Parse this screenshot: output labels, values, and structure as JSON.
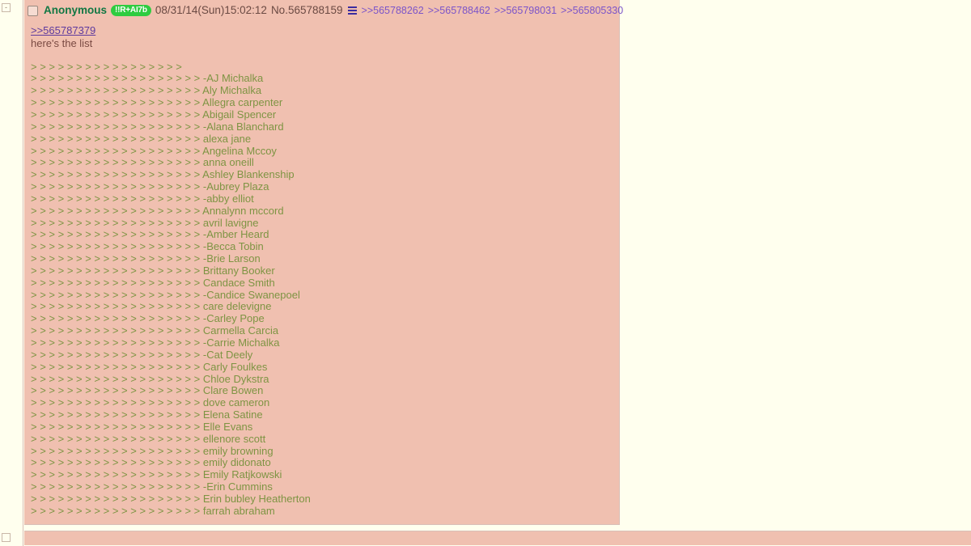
{
  "post": {
    "collapse_label": "-",
    "name": "Anonymous",
    "tripcode_badge": "!!R+AI7b",
    "datetime": "08/31/14(Sun)15:02:12",
    "post_number": "No.565788159",
    "menu_icon": "hamburger-menu-icon",
    "backlinks": [
      ">>565788262",
      ">>565788462",
      ">>565798031",
      ">>565805330"
    ],
    "message": {
      "quotelink": ">>565787379",
      "intro": "here's the list",
      "green_lines": [
        "> > > > > > > > > > > > > > > > >",
        "> > > > > > > > > > > > > > > > > > > -AJ Michalka",
        "> > > > > > > > > > > > > > > > > > > Aly Michalka",
        "> > > > > > > > > > > > > > > > > > > Allegra carpenter",
        "> > > > > > > > > > > > > > > > > > > Abigail Spencer",
        "> > > > > > > > > > > > > > > > > > > -Alana Blanchard",
        "> > > > > > > > > > > > > > > > > > > alexa jane",
        "> > > > > > > > > > > > > > > > > > > Angelina Mccoy",
        "> > > > > > > > > > > > > > > > > > > anna oneill",
        "> > > > > > > > > > > > > > > > > > > Ashley Blankenship",
        "> > > > > > > > > > > > > > > > > > > -Aubrey Plaza",
        "> > > > > > > > > > > > > > > > > > > -abby elliot",
        "> > > > > > > > > > > > > > > > > > > Annalynn mccord",
        "> > > > > > > > > > > > > > > > > > > avril lavigne",
        "> > > > > > > > > > > > > > > > > > > -Amber Heard",
        "> > > > > > > > > > > > > > > > > > > -Becca Tobin",
        "> > > > > > > > > > > > > > > > > > > -Brie Larson",
        "> > > > > > > > > > > > > > > > > > > Brittany Booker",
        "> > > > > > > > > > > > > > > > > > > Candace Smith",
        "> > > > > > > > > > > > > > > > > > > -Candice Swanepoel",
        "> > > > > > > > > > > > > > > > > > > care delevigne",
        "> > > > > > > > > > > > > > > > > > > -Carley Pope",
        "> > > > > > > > > > > > > > > > > > > Carmella Carcia",
        "> > > > > > > > > > > > > > > > > > > -Carrie Michalka",
        "> > > > > > > > > > > > > > > > > > > -Cat Deely",
        "> > > > > > > > > > > > > > > > > > > Carly Foulkes",
        "> > > > > > > > > > > > > > > > > > > Chloe Dykstra",
        "> > > > > > > > > > > > > > > > > > > Clare Bowen",
        "> > > > > > > > > > > > > > > > > > > dove cameron",
        "> > > > > > > > > > > > > > > > > > > Elena Satine",
        "> > > > > > > > > > > > > > > > > > > Elle Evans",
        "> > > > > > > > > > > > > > > > > > > ellenore scott",
        "> > > > > > > > > > > > > > > > > > > emily browning",
        "> > > > > > > > > > > > > > > > > > > emily didonato",
        "> > > > > > > > > > > > > > > > > > > Emily Ratjkowski",
        "> > > > > > > > > > > > > > > > > > > -Erin Cummins",
        "> > > > > > > > > > > > > > > > > > > Erin bubley Heatherton",
        "> > > > > > > > > > > > > > > > > > > farrah abraham"
      ]
    }
  },
  "next_post": {
    "collapse_label": ""
  },
  "colors": {
    "page_background": "#FFFFEE",
    "post_background": "#F0C0B0",
    "post_border": "#D9BFB7",
    "name_green": "#117743",
    "tripcode_green": "#2ECC40",
    "greentext": "#7E9443",
    "quotelink_purple": "#5E3A9E",
    "backlink_purple": "#7B54C9",
    "body_text": "#800000"
  }
}
